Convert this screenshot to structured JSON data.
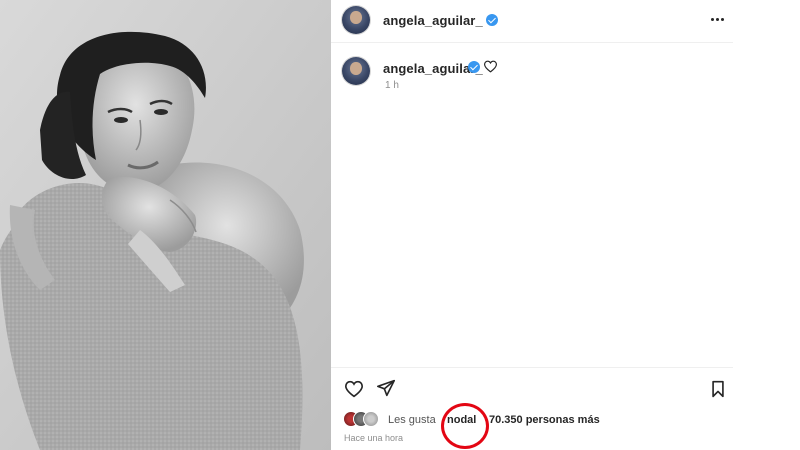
{
  "post": {
    "header": {
      "username": "angela_aguilar_",
      "verified": true,
      "more_icon": "more-horizontal-icon"
    },
    "caption": {
      "username": "angela_aguilar_",
      "verified": true,
      "time": "1 h",
      "like_icon": "heart-outline-icon"
    },
    "actions": {
      "like_icon": "heart-outline-icon",
      "share_icon": "send-icon",
      "save_icon": "bookmark-icon"
    },
    "likes": {
      "prefix": "Les gusta",
      "user": "nodal",
      "suffix": "70.350 personas más"
    },
    "posted": "Hace una hora"
  },
  "photo": {
    "style": "black-and-white portrait"
  },
  "highlight": {
    "color": "#e30613",
    "target": "nodal"
  },
  "colors": {
    "verified": "#3897f0",
    "text": "#262626",
    "muted": "#8e8e8e"
  }
}
